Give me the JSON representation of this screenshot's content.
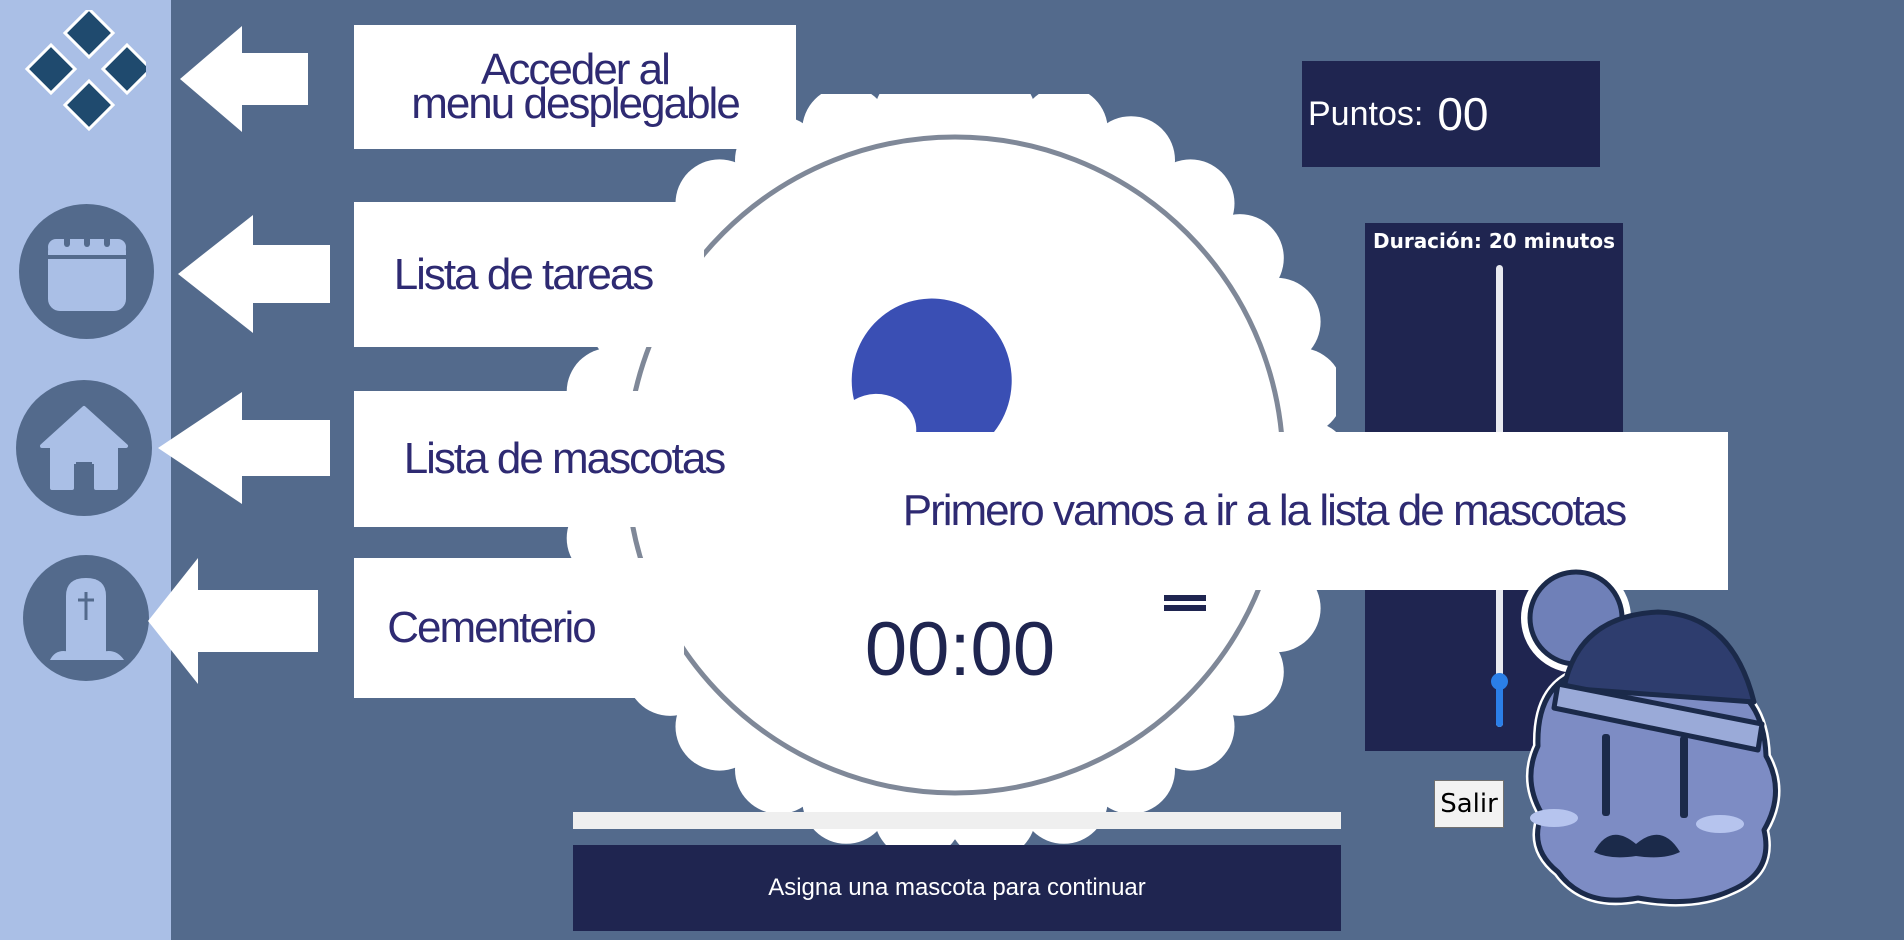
{
  "tutorial": {
    "menu_label_line1": "Acceder al",
    "menu_label_line2": "menu desplegable",
    "tasks_label": "Lista de tareas",
    "pets_label": "Lista de mascotas",
    "cemetery_label": "Cementerio"
  },
  "sidebar": {
    "items": [
      {
        "icon": "diamond-menu-icon"
      },
      {
        "icon": "calendar-icon"
      },
      {
        "icon": "home-icon"
      },
      {
        "icon": "gravestone-icon"
      }
    ]
  },
  "points": {
    "label": "Puntos:",
    "value": "00"
  },
  "duration": {
    "label": "Duración: 20 minutos",
    "slider_fraction": 0.1
  },
  "timer": {
    "display": "00:00",
    "progress": 0
  },
  "callout": {
    "text": "Primero vamos a ir a la lista de mascotas"
  },
  "buttons": {
    "salir": "Salir"
  },
  "status": {
    "assign_pet": "Asigna una mascota para continuar"
  },
  "colors": {
    "background": "#536a8c",
    "sidebar": "#aabfe6",
    "panel_dark": "#1f2550",
    "accent_blue": "#3a4fb4",
    "slider_blue": "#2b7fe8",
    "label_text": "#2e2a72"
  }
}
